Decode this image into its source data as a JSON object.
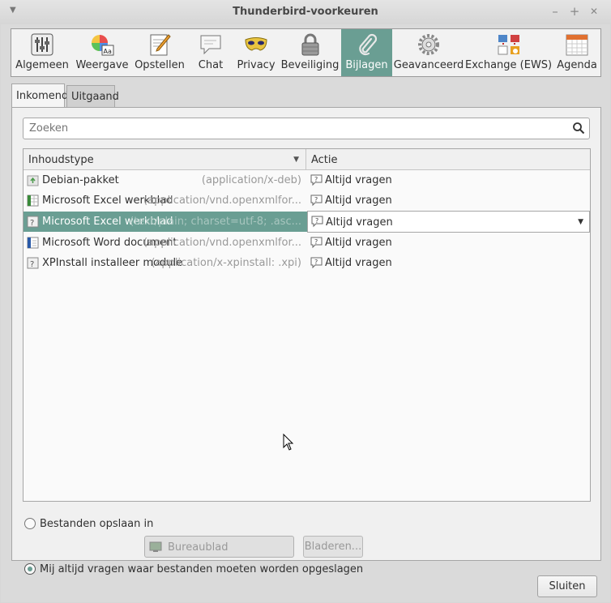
{
  "window": {
    "title": "Thunderbird-voorkeuren",
    "menu_icon": "chevron-down-icon",
    "minimize_label": "–",
    "maximize_label": "+",
    "close_label": "✕"
  },
  "toolbar": {
    "items": [
      {
        "label": "Algemeen",
        "icon": "sliders-icon"
      },
      {
        "label": "Weergave",
        "icon": "color-font-icon"
      },
      {
        "label": "Opstellen",
        "icon": "compose-pencil-icon"
      },
      {
        "label": "Chat",
        "icon": "chat-bubble-icon"
      },
      {
        "label": "Privacy",
        "icon": "mask-icon"
      },
      {
        "label": "Beveiliging",
        "icon": "padlock-icon"
      },
      {
        "label": "Bijlagen",
        "icon": "paperclip-icon",
        "active": true
      },
      {
        "label": "Geavanceerd",
        "icon": "gear-icon"
      },
      {
        "label": "Exchange (EWS)",
        "icon": "exchange-icon"
      },
      {
        "label": "Agenda",
        "icon": "calendar-icon"
      }
    ]
  },
  "tabs": [
    {
      "label": "Inkomend",
      "active": true
    },
    {
      "label": "Uitgaand",
      "active": false
    }
  ],
  "search": {
    "placeholder": "Zoeken"
  },
  "table": {
    "columns": [
      "Inhoudstype",
      "Actie"
    ],
    "rows": [
      {
        "name": "Debian-pakket",
        "mime": "(application/x-deb)",
        "action": "Altijd vragen",
        "icon": "package-icon"
      },
      {
        "name": "Microsoft Excel werkblad",
        "mime": "(application/vnd.openxmlfor...",
        "action": "Altijd vragen",
        "icon": "spreadsheet-icon"
      },
      {
        "name": "Microsoft Excel werkblad",
        "mime": "(text/plain; charset=utf-8; .asc...",
        "action": "Altijd vragen",
        "icon": "unknown-file-icon",
        "selected": true
      },
      {
        "name": "Microsoft Word document",
        "mime": "(application/vnd.openxmlfor...",
        "action": "Altijd vragen",
        "icon": "document-icon"
      },
      {
        "name": "XPInstall installeer module",
        "mime": "(application/x-xpinstall: .xpi)",
        "action": "Altijd vragen",
        "icon": "unknown-file-icon"
      }
    ]
  },
  "save_options": {
    "save_in_label": "Bestanden opslaan in",
    "folder_value": "Bureaublad",
    "browse_label": "Bladeren...",
    "always_ask_label": "Mij altijd vragen waar bestanden moeten worden opgeslagen",
    "selected": "always_ask"
  },
  "footer": {
    "close_label": "Sluiten"
  },
  "colors": {
    "accent": "#6a9e93",
    "panel": "#f0f0f0",
    "window": "#dadada"
  }
}
